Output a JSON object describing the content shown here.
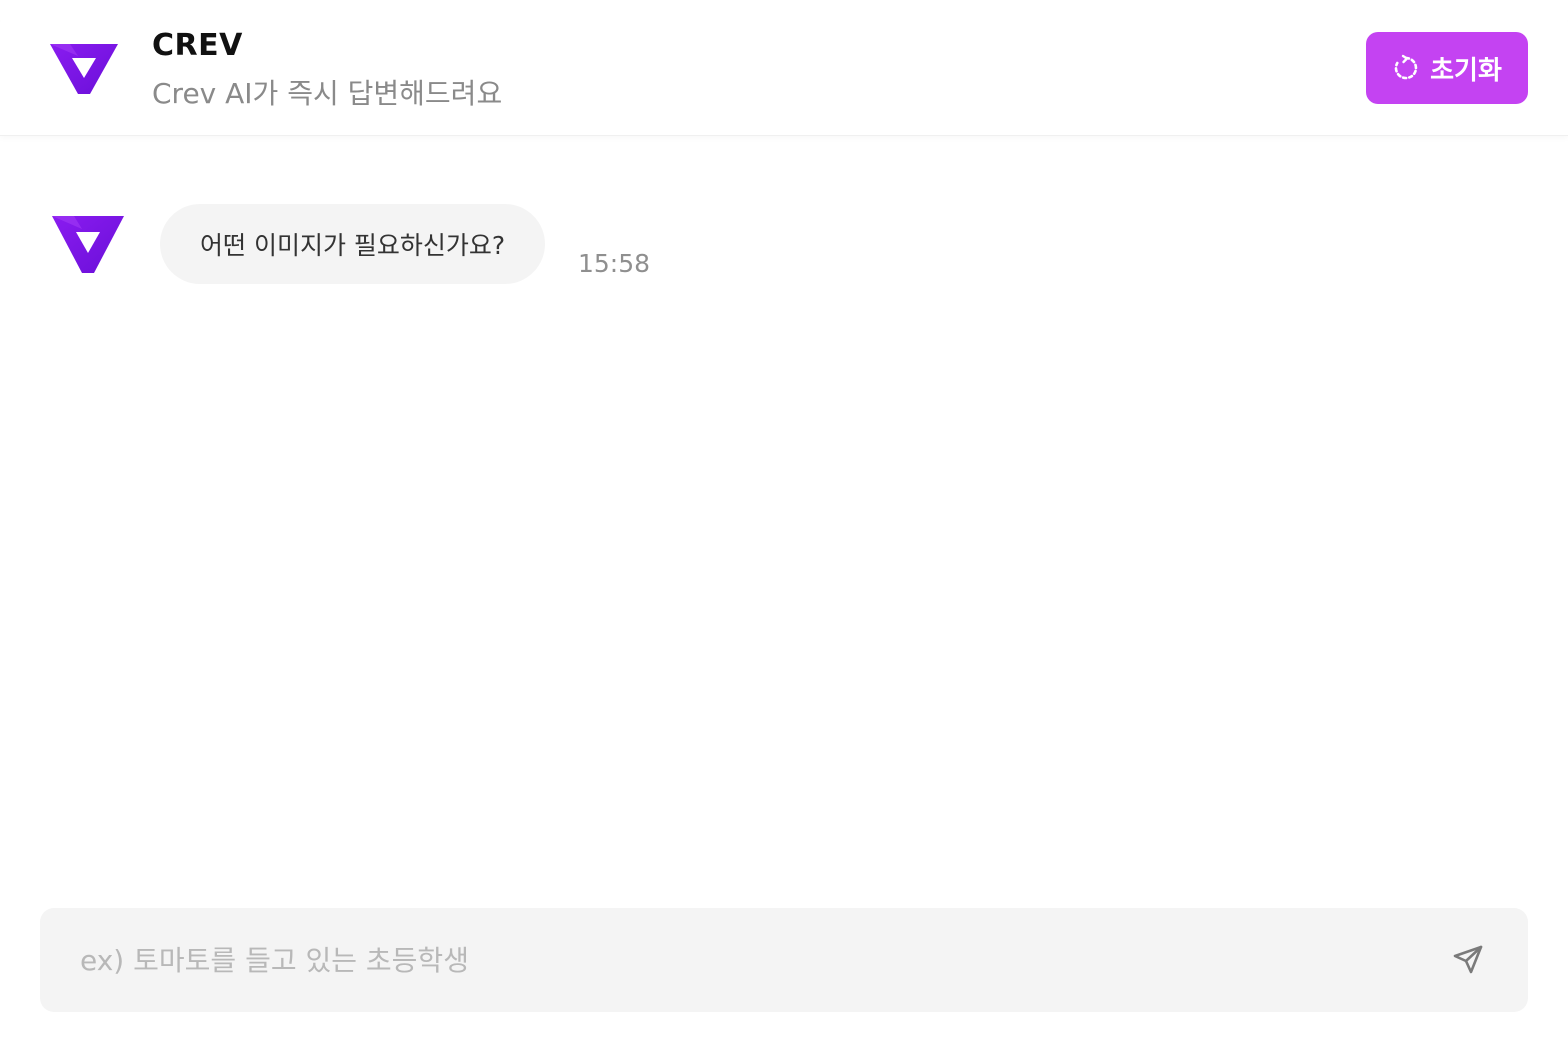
{
  "header": {
    "logo_icon": "crev-logo-icon",
    "title": "CREV",
    "subtitle": "Crev AI가 즉시 답변해드려요",
    "reset_button": {
      "icon": "refresh-icon",
      "label": "초기화"
    }
  },
  "messages": [
    {
      "sender": "bot",
      "avatar_icon": "crev-logo-icon",
      "text": "어떤 이미지가 필요하신가요?",
      "time": "15:58"
    }
  ],
  "composer": {
    "value": "",
    "placeholder": "ex) 토마토를 들고 있는 초등학생",
    "send_icon": "send-icon"
  },
  "colors": {
    "accent": "#c443f2",
    "logo_purple": "#7b12e6",
    "bubble_bg": "#f4f4f4",
    "input_bg": "#f4f4f4",
    "muted_text": "#8a8a8a"
  }
}
